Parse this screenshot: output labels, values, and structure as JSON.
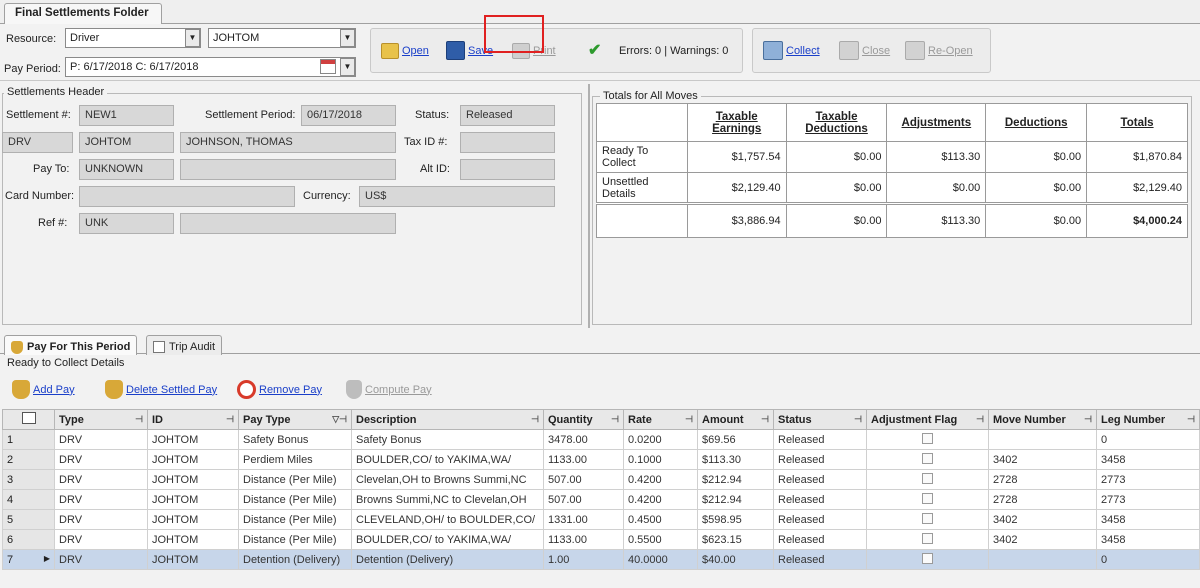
{
  "window_tab": "Final Settlements Folder",
  "resource": {
    "label": "Resource:",
    "type_value": "Driver",
    "id_value": "JOHTOM"
  },
  "pay_period": {
    "label": "Pay Period:",
    "value": "P: 6/17/2018  C: 6/17/2018"
  },
  "toolbar": {
    "open": "Open",
    "save": "Save",
    "print": "Print",
    "status": "Errors: 0 | Warnings: 0",
    "collect": "Collect",
    "close": "Close",
    "reopen": "Re-Open"
  },
  "header": {
    "title": "Settlements Header",
    "settlement_no_label": "Settlement #:",
    "settlement_no": "NEW1",
    "period_label": "Settlement Period:",
    "period": "06/17/2018",
    "status_label": "Status:",
    "status": "Released",
    "type": "DRV",
    "id": "JOHTOM",
    "name": "JOHNSON, THOMAS",
    "taxid_label": "Tax ID #:",
    "taxid": "",
    "payto_label": "Pay To:",
    "payto": "UNKNOWN",
    "payto_name": "",
    "altid_label": "Alt ID:",
    "altid": "",
    "card_label": "Card Number:",
    "card": "",
    "currency_label": "Currency:",
    "currency": "US$",
    "ref_label": "Ref #:",
    "ref": "UNK",
    "ref2": ""
  },
  "totals": {
    "title": "Totals for All Moves",
    "columns": [
      "Taxable Earnings",
      "Taxable Deductions",
      "Adjustments",
      "Deductions",
      "Totals"
    ],
    "rows": [
      {
        "label": "Ready To Collect",
        "values": [
          "$1,757.54",
          "$0.00",
          "$113.30",
          "$0.00",
          "$1,870.84"
        ]
      },
      {
        "label": "Unsettled Details",
        "values": [
          "$2,129.40",
          "$0.00",
          "$0.00",
          "$0.00",
          "$2,129.40"
        ]
      },
      {
        "label": "",
        "values": [
          "$3,886.94",
          "$0.00",
          "$113.30",
          "$0.00",
          "$4,000.24"
        ]
      }
    ]
  },
  "lower_tabs": [
    "Pay For This Period",
    "Trip Audit"
  ],
  "details_title": "Ready to Collect Details",
  "actions": {
    "add": "Add Pay",
    "delete": "Delete Settled Pay",
    "remove": "Remove Pay",
    "compute": "Compute Pay"
  },
  "grid": {
    "columns": [
      "Type",
      "ID",
      "Pay Type",
      "Description",
      "Quantity",
      "Rate",
      "Amount",
      "Status",
      "Adjustment Flag",
      "Move Number",
      "Leg Number"
    ],
    "rows": [
      [
        "1",
        "DRV",
        "JOHTOM",
        "Safety Bonus",
        "Safety Bonus",
        "3478.00",
        "0.0200",
        "$69.56",
        "Released",
        "",
        "",
        "0"
      ],
      [
        "2",
        "DRV",
        "JOHTOM",
        "Perdiem Miles",
        "BOULDER,CO/ to YAKIMA,WA/",
        "1133.00",
        "0.1000",
        "$113.30",
        "Released",
        "",
        "3402",
        "3458"
      ],
      [
        "3",
        "DRV",
        "JOHTOM",
        "Distance (Per Mile)",
        "Clevelan,OH to Browns Summi,NC",
        "507.00",
        "0.4200",
        "$212.94",
        "Released",
        "",
        "2728",
        "2773"
      ],
      [
        "4",
        "DRV",
        "JOHTOM",
        "Distance (Per Mile)",
        "Browns Summi,NC to Clevelan,OH",
        "507.00",
        "0.4200",
        "$212.94",
        "Released",
        "",
        "2728",
        "2773"
      ],
      [
        "5",
        "DRV",
        "JOHTOM",
        "Distance (Per Mile)",
        "CLEVELAND,OH/ to BOULDER,CO/",
        "1331.00",
        "0.4500",
        "$598.95",
        "Released",
        "",
        "3402",
        "3458"
      ],
      [
        "6",
        "DRV",
        "JOHTOM",
        "Distance (Per Mile)",
        "BOULDER,CO/ to YAKIMA,WA/",
        "1133.00",
        "0.5500",
        "$623.15",
        "Released",
        "",
        "3402",
        "3458"
      ],
      [
        "7",
        "DRV",
        "JOHTOM",
        "Detention (Delivery)",
        "Detention (Delivery)",
        "1.00",
        "40.0000",
        "$40.00",
        "Released",
        "",
        "",
        "0"
      ]
    ]
  }
}
